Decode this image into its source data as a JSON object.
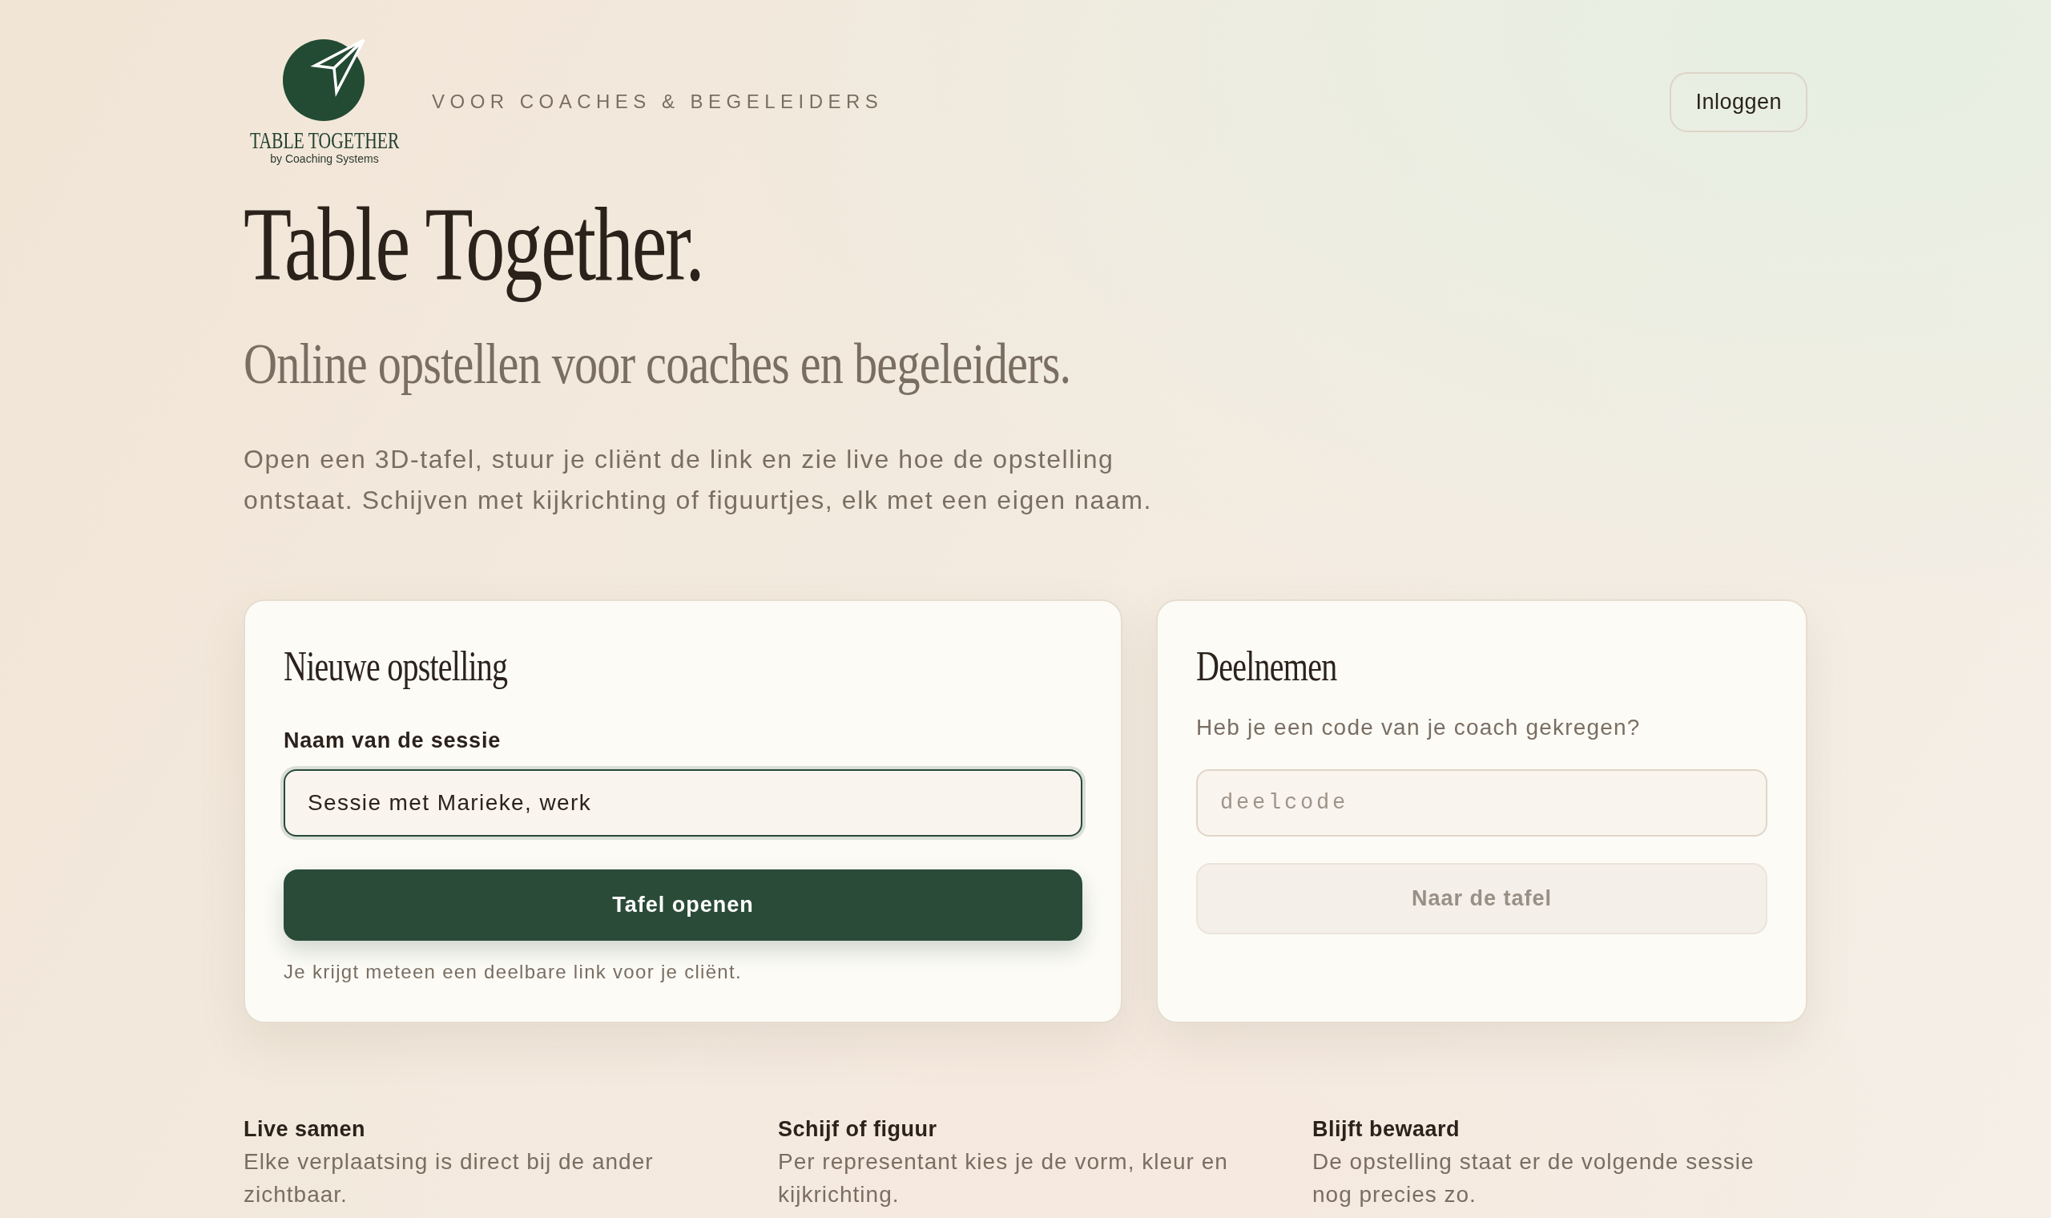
{
  "header": {
    "logo": {
      "name": "TABLE TOGETHER",
      "byline": "by Coaching Systems"
    },
    "tagline": "VOOR COACHES & BEGELEIDERS",
    "login_button": "Inloggen"
  },
  "hero": {
    "title": "Table Together.",
    "subtitle": "Online opstellen voor coaches en begeleiders.",
    "intro": "Open een 3D-tafel, stuur je cliënt de link en zie live hoe de opstelling ontstaat. Schijven met kijkrichting of figuurtjes, elk met een eigen naam."
  },
  "cards": [
    {
      "title": "Nieuwe opstelling",
      "label": "Naam van de sessie",
      "field": {
        "kind": "text",
        "value": "Sessie met Marieke, werk",
        "focused": true
      },
      "button": {
        "label": "Tafel openen",
        "disabled": false
      },
      "hint": "Je krijgt meteen een deelbare link voor je cliënt."
    },
    {
      "title": "Deelnemen",
      "prompt": "Heb je een code van je coach gekregen?",
      "field": {
        "kind": "code",
        "placeholder": "deelcode",
        "focused": false
      },
      "button": {
        "label": "Naar de tafel",
        "disabled": true
      }
    }
  ],
  "features": [
    {
      "title": "Live samen",
      "text": "Elke verplaatsing is direct bij de ander zichtbaar."
    },
    {
      "title": "Schijf of figuur",
      "text": "Per representant kies je de vorm, kleur en kijkrichting."
    },
    {
      "title": "Blijft bewaard",
      "text": "De opstelling staat er de volgende sessie nog precies zo."
    }
  ]
}
